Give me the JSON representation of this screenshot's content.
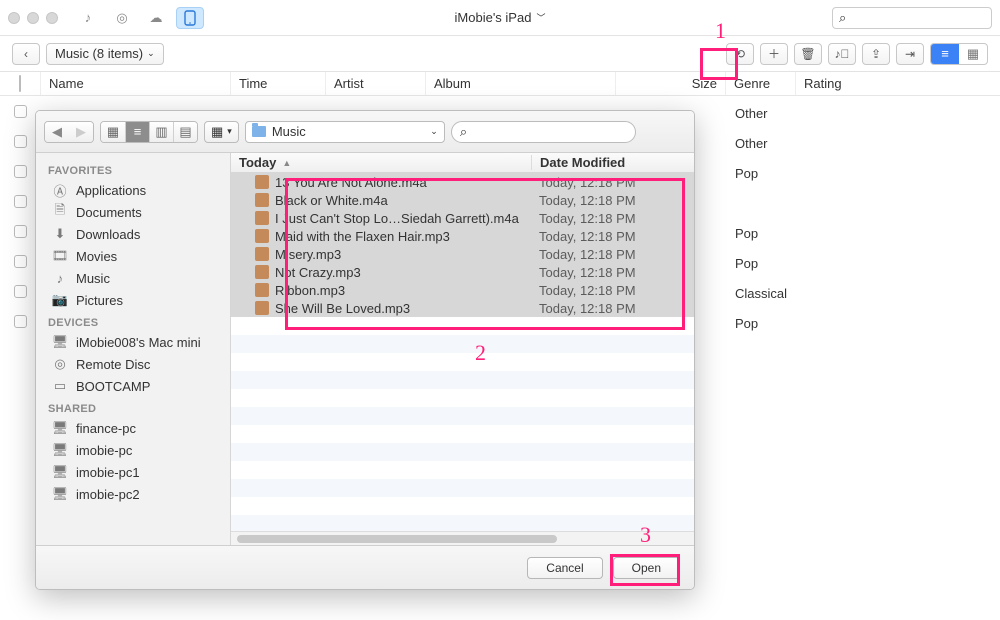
{
  "window": {
    "title": "iMobie's iPad"
  },
  "toolbar": {
    "crumb": "Music (8 items)"
  },
  "columns": {
    "name": "Name",
    "time": "Time",
    "artist": "Artist",
    "album": "Album",
    "size": "Size",
    "genre": "Genre",
    "rating": "Rating"
  },
  "genres": [
    "Other",
    "Other",
    "Pop",
    "",
    "Pop",
    "Pop",
    "Classical",
    "Pop"
  ],
  "finder": {
    "path": "Music",
    "headers": {
      "today": "Today",
      "dateModified": "Date Modified"
    },
    "sidebar": {
      "favorites_h": "FAVORITES",
      "favorites": [
        "Applications",
        "Documents",
        "Downloads",
        "Movies",
        "Music",
        "Pictures"
      ],
      "devices_h": "DEVICES",
      "devices": [
        "iMobie008's Mac mini",
        "Remote Disc",
        "BOOTCAMP"
      ],
      "shared_h": "SHARED",
      "shared": [
        "finance-pc",
        "imobie-pc",
        "imobie-pc1",
        "imobie-pc2"
      ]
    },
    "files": [
      {
        "name": "13 You Are Not Alone.m4a",
        "date": "Today, 12:18 PM"
      },
      {
        "name": "Black or White.m4a",
        "date": "Today, 12:18 PM"
      },
      {
        "name": "I Just Can't Stop Lo…Siedah Garrett).m4a",
        "date": "Today, 12:18 PM"
      },
      {
        "name": "Maid with the Flaxen Hair.mp3",
        "date": "Today, 12:18 PM"
      },
      {
        "name": "Misery.mp3",
        "date": "Today, 12:18 PM"
      },
      {
        "name": "Not Crazy.mp3",
        "date": "Today, 12:18 PM"
      },
      {
        "name": "Ribbon.mp3",
        "date": "Today, 12:18 PM"
      },
      {
        "name": "She Will Be Loved.mp3",
        "date": "Today, 12:18 PM"
      }
    ],
    "buttons": {
      "cancel": "Cancel",
      "open": "Open"
    }
  },
  "annotations": {
    "n1": "1",
    "n2": "2",
    "n3": "3"
  }
}
